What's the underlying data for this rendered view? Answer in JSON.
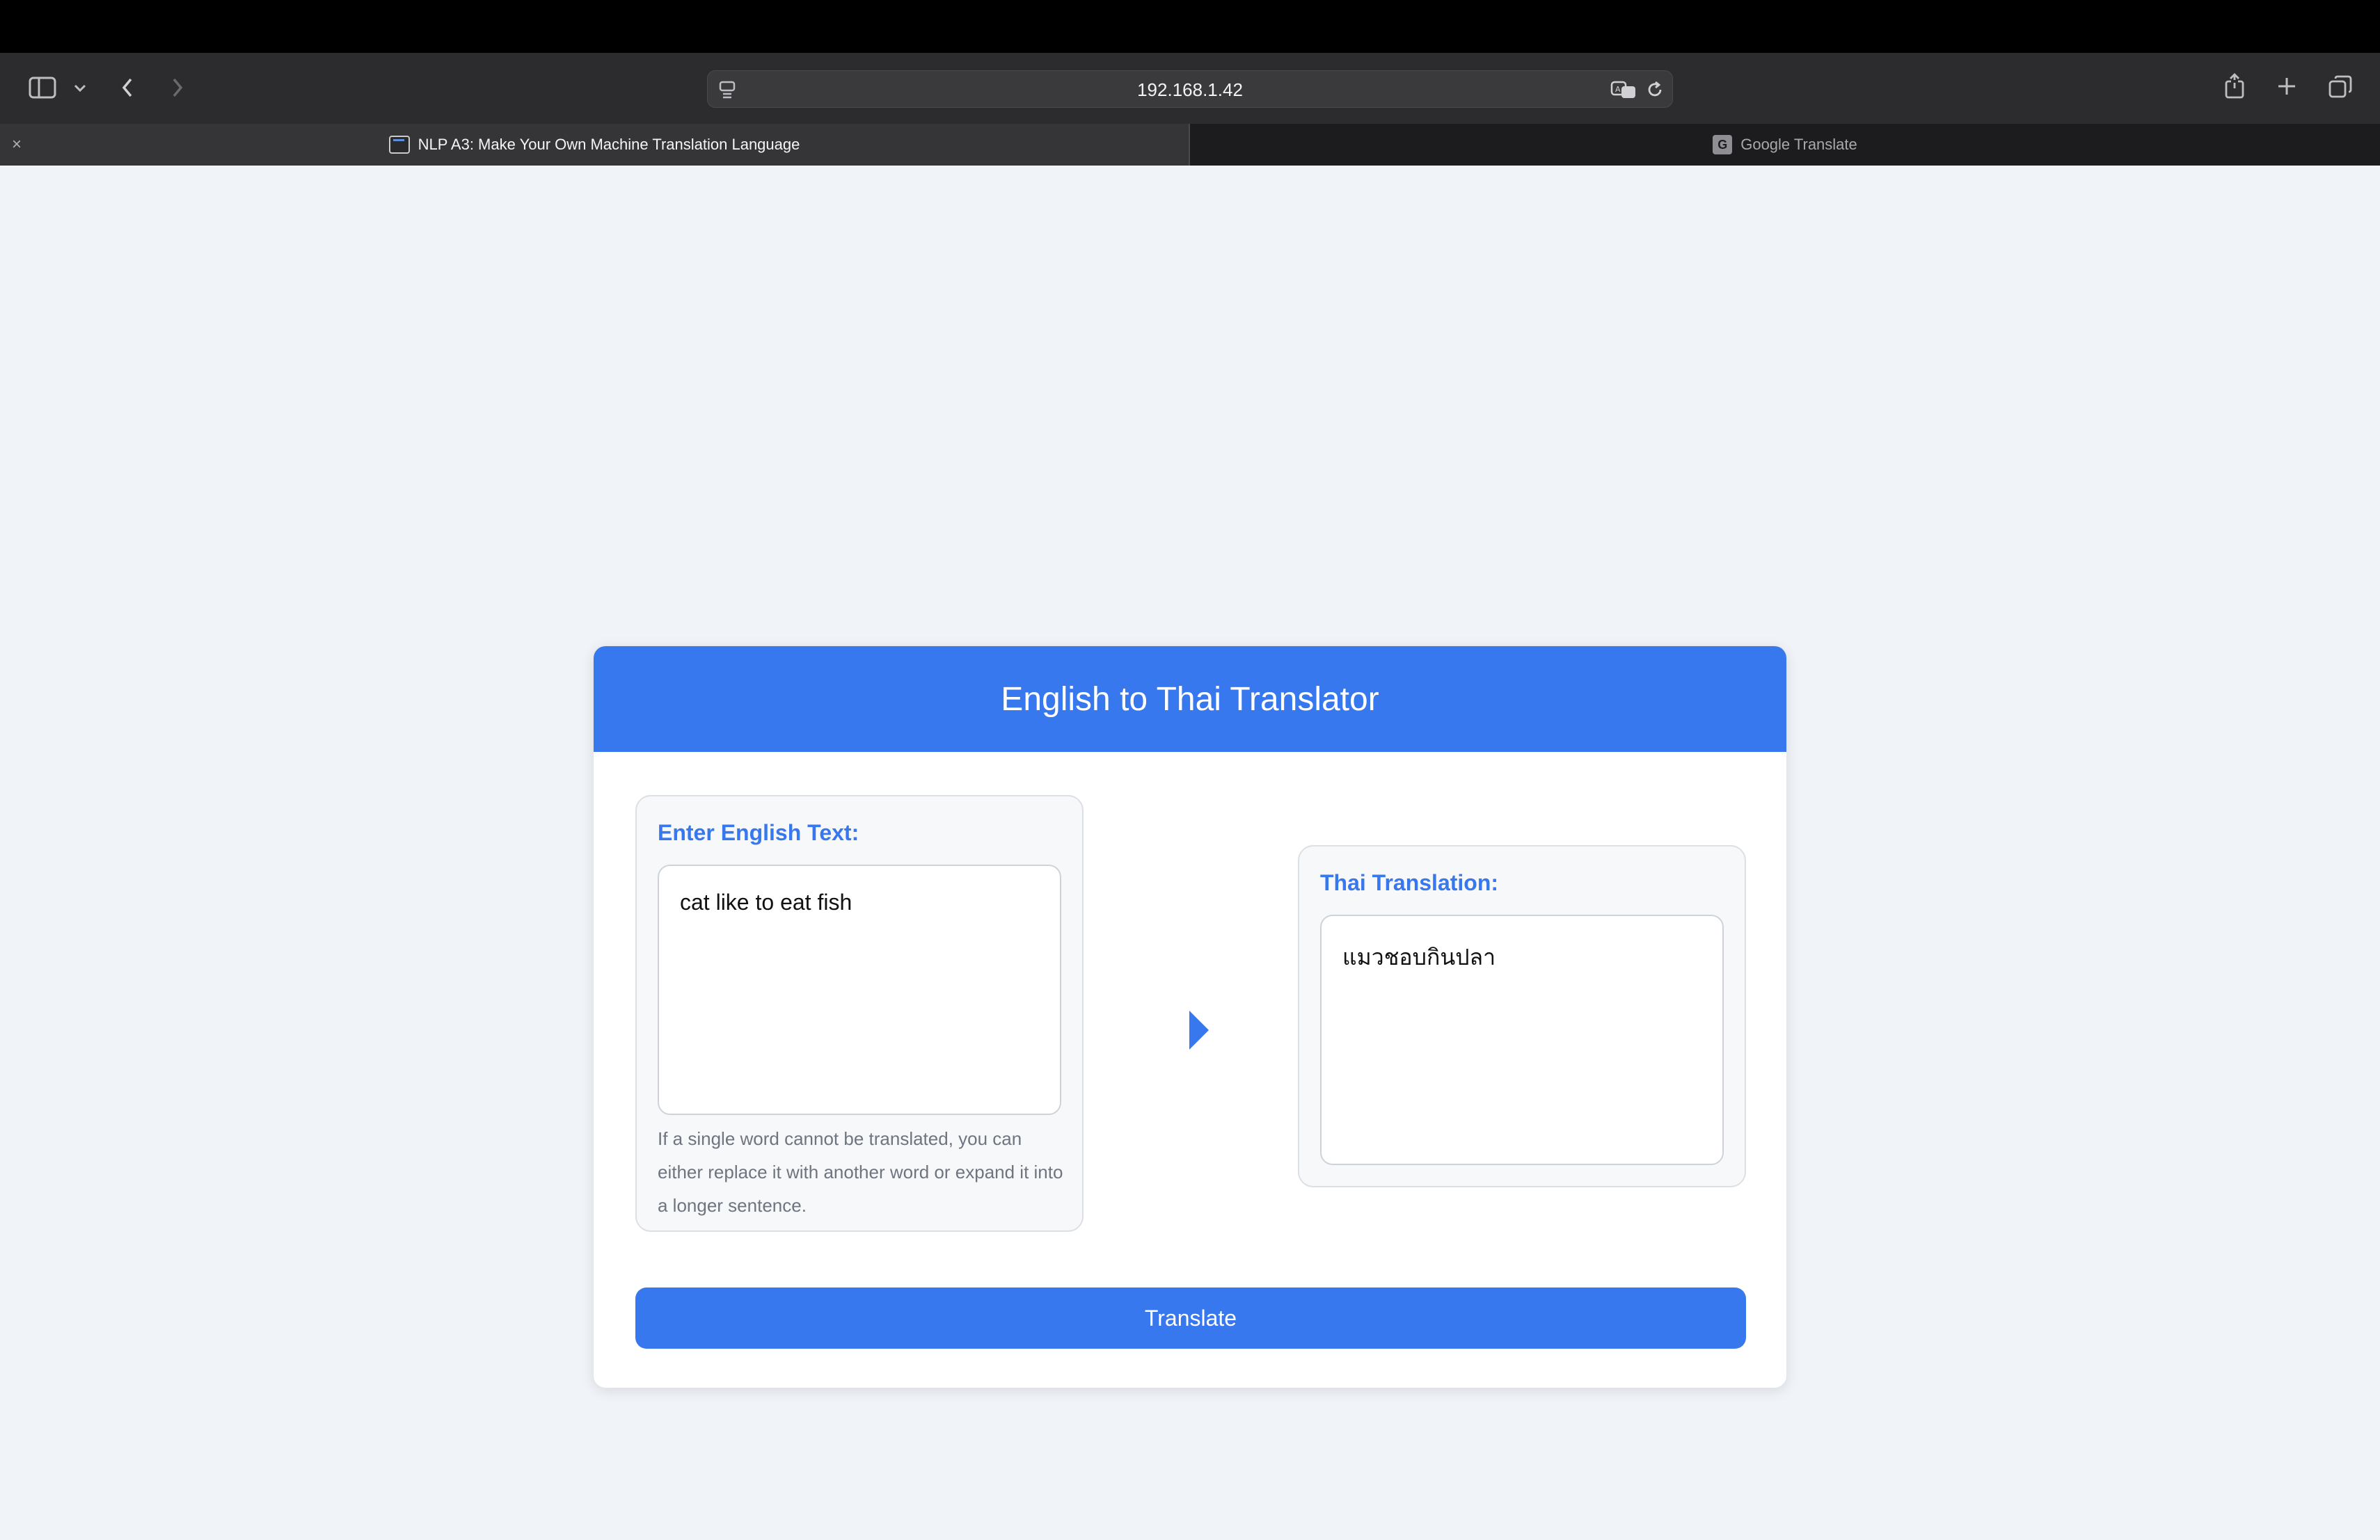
{
  "browser": {
    "url": "192.168.1.42",
    "tabs": [
      {
        "title": "NLP A3: Make Your Own Machine Translation Language",
        "active": true,
        "favicon": "terminal-icon"
      },
      {
        "title": "Google Translate",
        "active": false,
        "favicon": "G"
      }
    ],
    "close_glyph": "×"
  },
  "app": {
    "title": "English to Thai Translator",
    "input": {
      "label": "Enter English Text:",
      "value": "cat like to eat fish",
      "hint": "If a single word cannot be translated, you can either replace it with another word or expand it into a longer sentence."
    },
    "output": {
      "label": "Thai Translation:",
      "value": "แมวชอบกินปลา"
    },
    "translate_label": "Translate",
    "accent_color": "#3778ee"
  }
}
